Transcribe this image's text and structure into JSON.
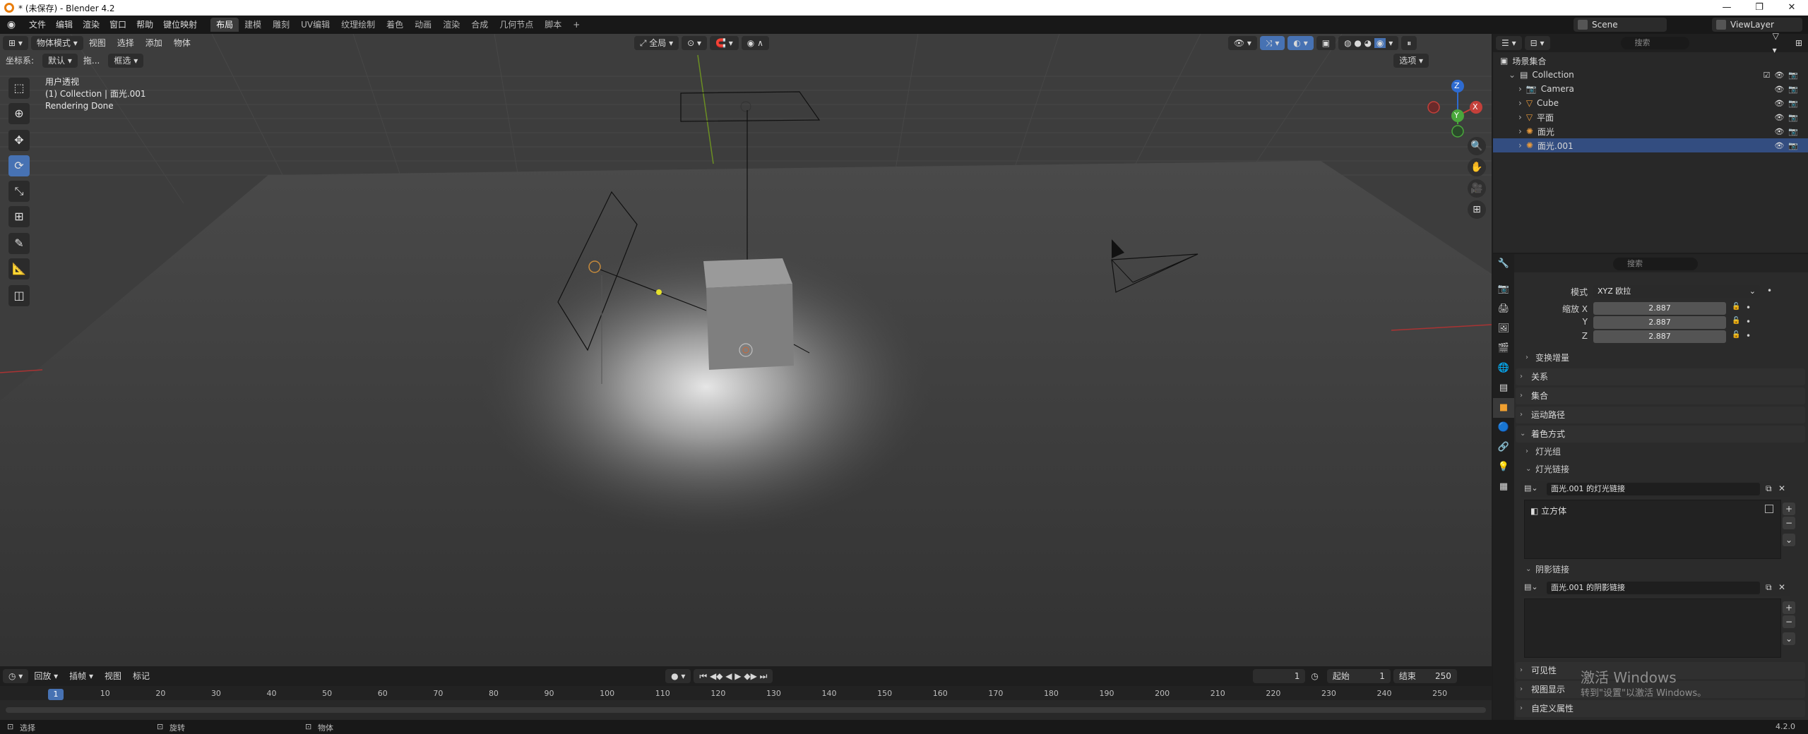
{
  "window": {
    "title": "* (未保存) - Blender 4.2",
    "controls": [
      "—",
      "❐",
      "✕"
    ]
  },
  "menu": [
    "文件",
    "编辑",
    "渲染",
    "窗口",
    "帮助",
    "键位映射"
  ],
  "workspaces": [
    "布局",
    "建模",
    "雕刻",
    "UV编辑",
    "纹理绘制",
    "着色",
    "动画",
    "渲染",
    "合成",
    "几何节点",
    "脚本",
    "+"
  ],
  "scene": "Scene",
  "view_layer": "ViewLayer",
  "viewport": {
    "mode": "物体模式",
    "menus": [
      "视图",
      "选择",
      "添加",
      "物体"
    ],
    "coord_label": "坐标系:",
    "coord_value": "默认",
    "drag_label": "拖...",
    "drag_value": "框选",
    "pivot": "全局",
    "options": "选项",
    "overlay_lines": [
      "用户透视",
      "(1) Collection | 面光.001",
      "Rendering Done"
    ],
    "gizmo": {
      "z": "Z",
      "y": "Y",
      "x": "X"
    }
  },
  "timeline": {
    "menus": [
      "回放",
      "插帧",
      "视图",
      "标记"
    ],
    "current_frame": "1",
    "start_label": "起始",
    "start": "1",
    "end_label": "结束",
    "end": "250",
    "frame_display": "1",
    "ruler": [
      "1",
      "10",
      "20",
      "30",
      "40",
      "50",
      "60",
      "70",
      "80",
      "90",
      "100",
      "110",
      "120",
      "130",
      "140",
      "150",
      "160",
      "170",
      "180",
      "190",
      "200",
      "210",
      "220",
      "230",
      "240",
      "250"
    ]
  },
  "statusbar": {
    "select": "选择",
    "rotate": "旋转",
    "object": "物体",
    "version": "4.2.0"
  },
  "outliner": {
    "search_placeholder": "搜索",
    "scene_collection": "场景集合",
    "collection": "Collection",
    "items": [
      {
        "name": "Camera",
        "icon": "camera-icon",
        "selected": false
      },
      {
        "name": "Cube",
        "icon": "mesh-icon",
        "selected": false
      },
      {
        "name": "平面",
        "icon": "mesh-icon",
        "selected": false
      },
      {
        "name": "面光",
        "icon": "light-icon",
        "selected": false
      },
      {
        "name": "面光.001",
        "icon": "light-icon",
        "selected": true
      }
    ]
  },
  "properties": {
    "search_placeholder": "搜索",
    "mode_label": "模式",
    "mode_value": "XYZ 欧拉",
    "scale_label": "缩放 X",
    "scale_x": "2.887",
    "y_label": "Y",
    "scale_y": "2.887",
    "z_label": "Z",
    "scale_z": "2.887",
    "delta": "变换增量",
    "sections": [
      "关系",
      "集合",
      "运动路径"
    ],
    "shading": "着色方式",
    "light_group": "灯光组",
    "light_linking": "灯光链接",
    "light_link_field": "面光.001 的灯光链接",
    "light_link_item": "立方体",
    "shadow_linking": "阴影链接",
    "shadow_link_field": "面光.001 的阴影链接",
    "bottom_sections": [
      "可见性",
      "视图显示",
      "自定义属性"
    ]
  },
  "activation": {
    "line1": "激活 Windows",
    "line2": "转到\"设置\"以激活 Windows。"
  }
}
